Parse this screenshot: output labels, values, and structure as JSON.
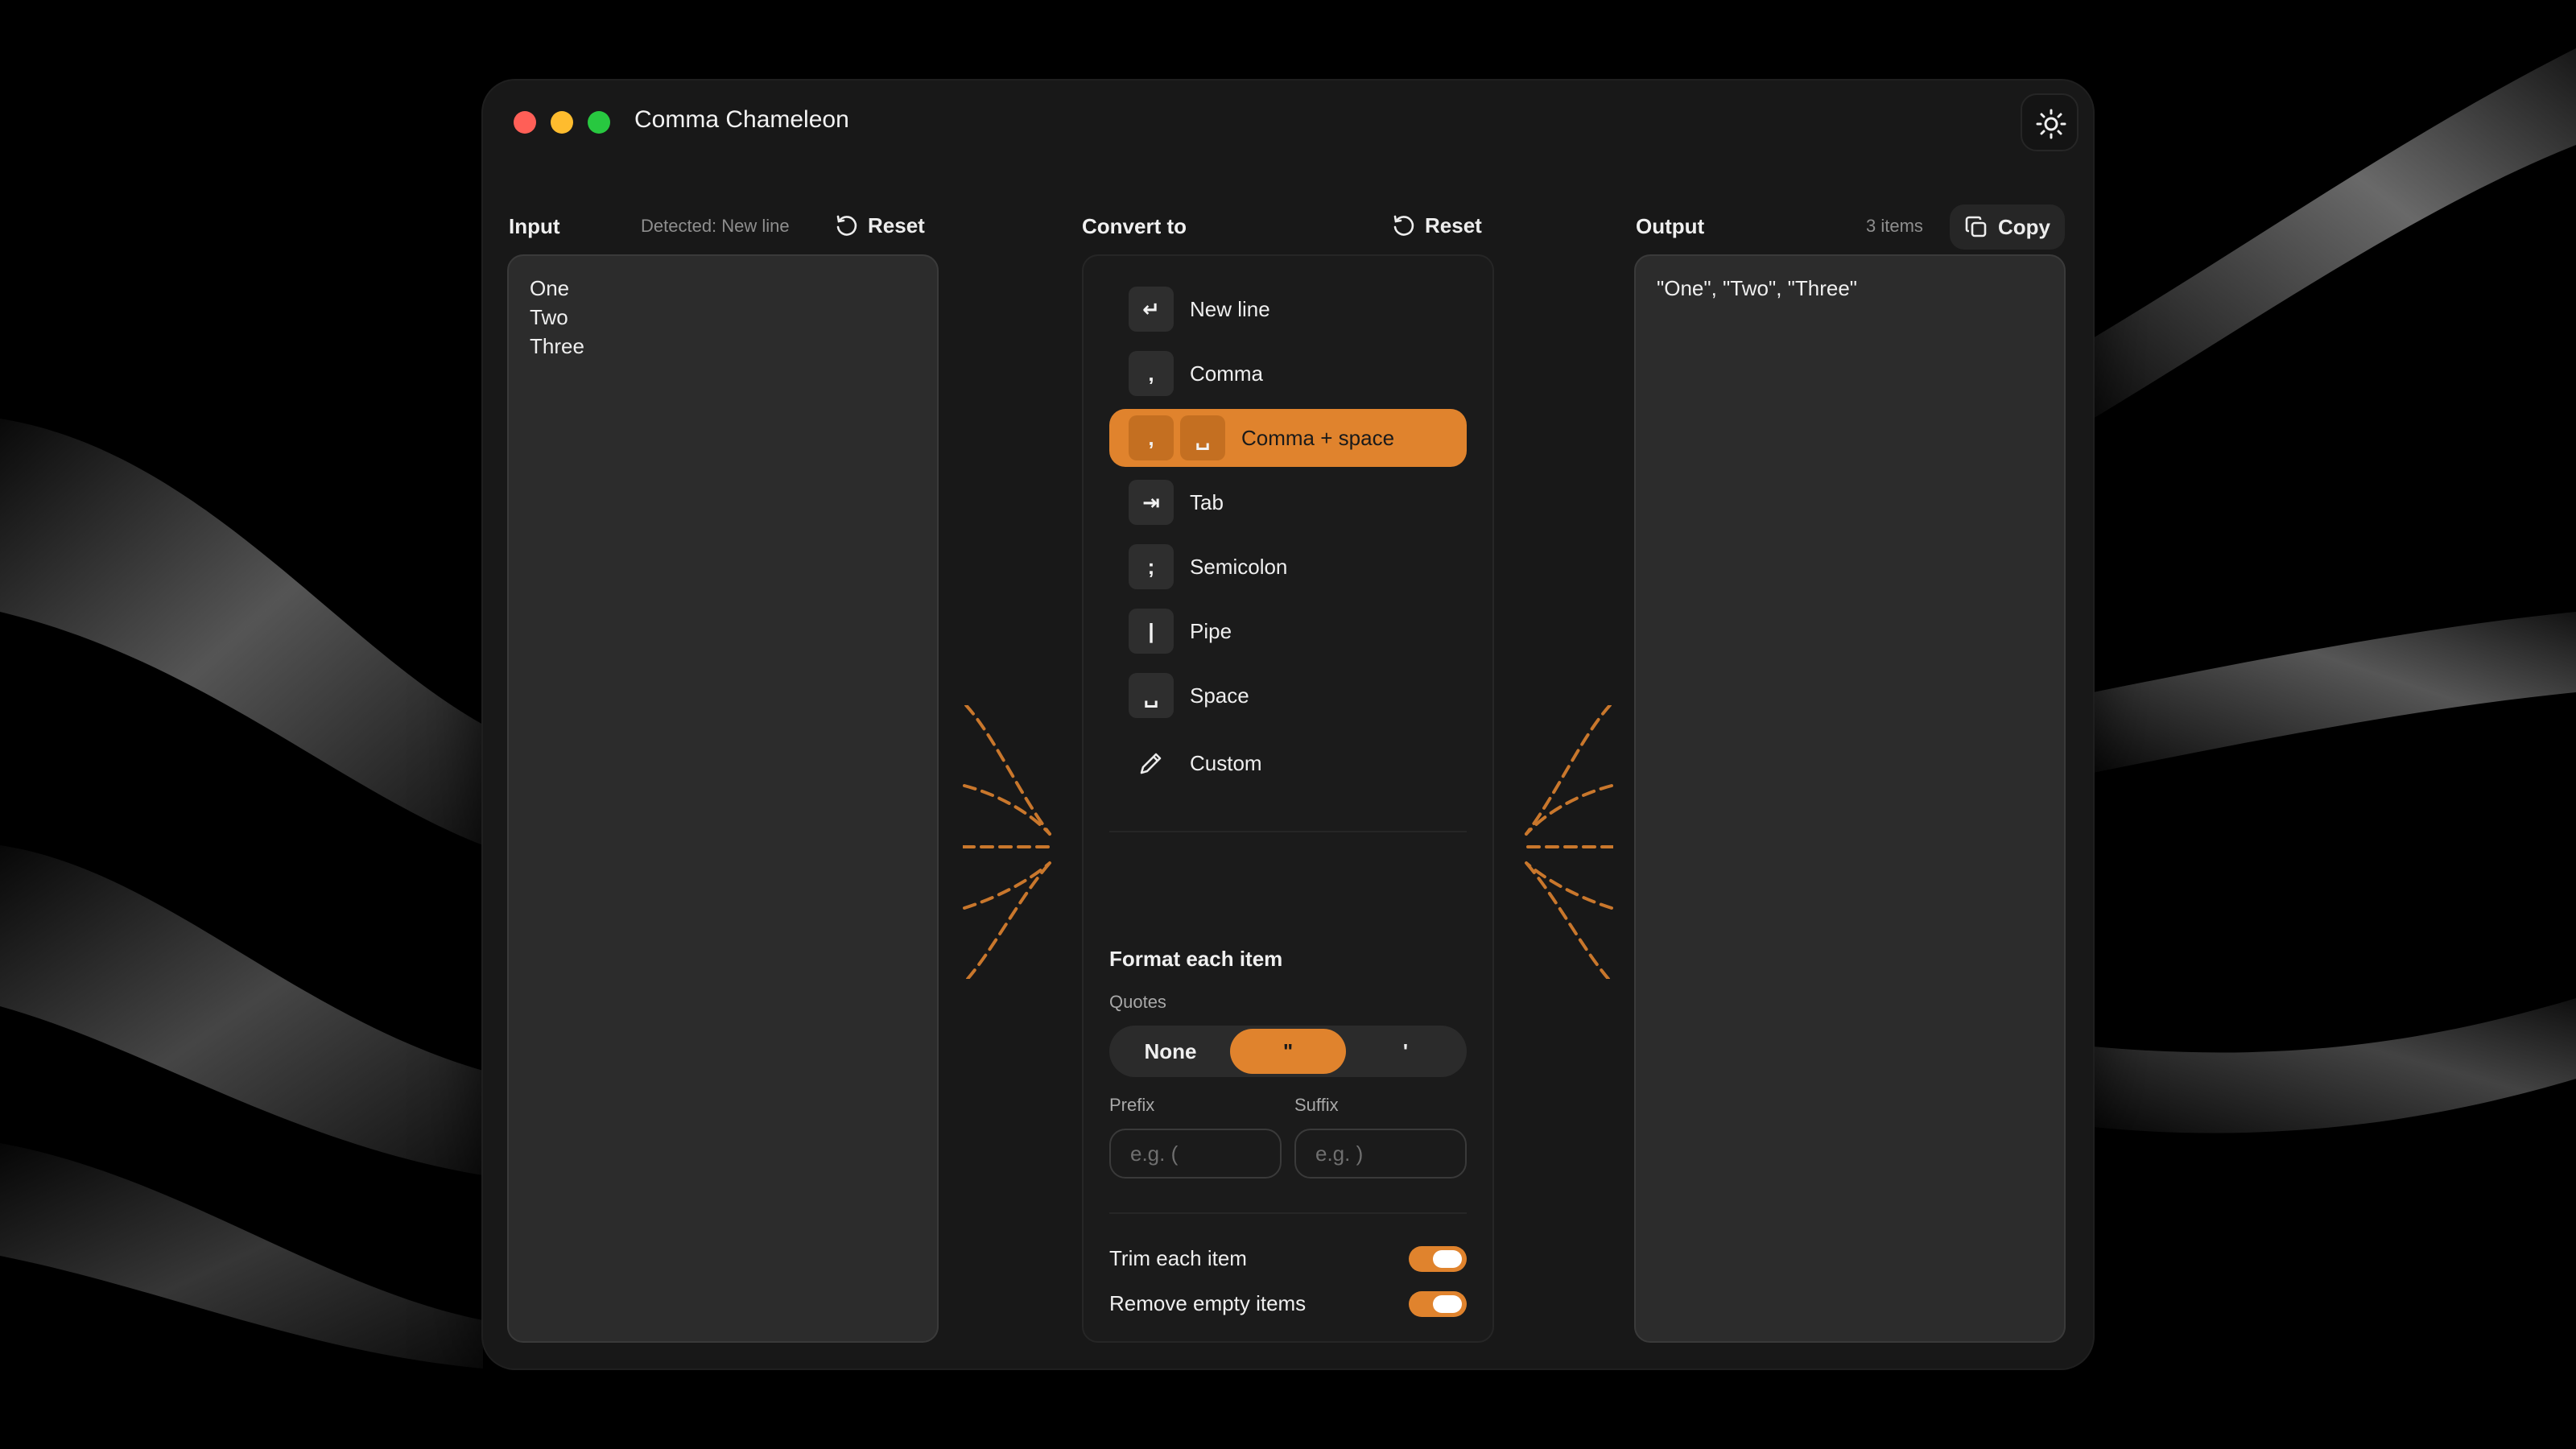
{
  "window": {
    "title": "Comma Chameleon"
  },
  "input": {
    "label": "Input",
    "detected": "Detected: New line",
    "reset_label": "Reset",
    "text": "One\nTwo\nThree"
  },
  "convert": {
    "label": "Convert to",
    "reset_label": "Reset",
    "options": [
      {
        "label": "New line",
        "key": "↵",
        "icon": "return-icon"
      },
      {
        "label": "Comma",
        "key": ",",
        "icon": "comma-icon"
      },
      {
        "label": "Comma + space",
        "keys": [
          ",",
          "␣"
        ],
        "icon": "comma-space-icon",
        "selected": true
      },
      {
        "label": "Tab",
        "key": "⇥",
        "icon": "tab-icon"
      },
      {
        "label": "Semicolon",
        "key": ";",
        "icon": "semicolon-icon"
      },
      {
        "label": "Pipe",
        "key": "|",
        "icon": "pipe-icon"
      },
      {
        "label": "Space",
        "key": "␣",
        "icon": "space-icon"
      },
      {
        "label": "Custom",
        "icon": "pencil-icon"
      }
    ],
    "format": {
      "title": "Format each item",
      "quotes_label": "Quotes",
      "quotes": [
        "None",
        "\"",
        "'"
      ],
      "quotes_selected": "\"",
      "prefix_label": "Prefix",
      "prefix_placeholder": "e.g. (",
      "suffix_label": "Suffix",
      "suffix_placeholder": "e.g. )",
      "trim_label": "Trim each item",
      "trim_on": true,
      "remove_empty_label": "Remove empty items",
      "remove_empty_on": true
    }
  },
  "output": {
    "label": "Output",
    "count": "3 items",
    "copy_label": "Copy",
    "text": "\"One\", \"Two\", \"Three\""
  },
  "colors": {
    "accent": "#e0832d",
    "window_bg": "#181818",
    "panel_bg": "#2c2c2c"
  }
}
